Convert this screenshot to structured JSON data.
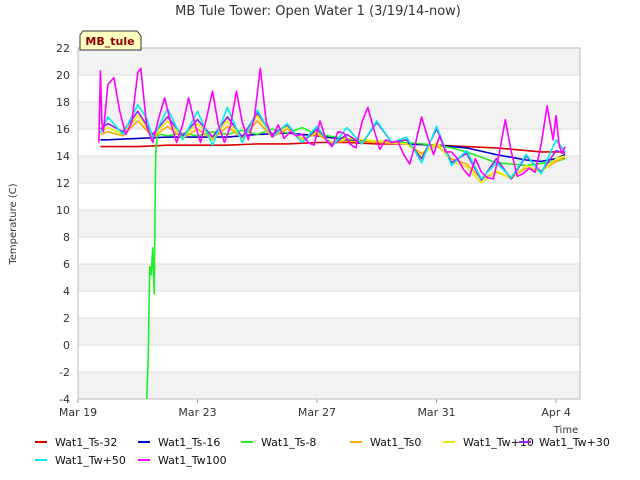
{
  "chart_data": {
    "type": "line",
    "title": "MB Tule Tower: Open Water 1 (3/19/14-now)",
    "badge": "MB_tule",
    "ylabel": "Temperature (C)",
    "xlabel": "Time",
    "ylim": [
      -4,
      22
    ],
    "yticks": [
      -4,
      -2,
      0,
      2,
      4,
      6,
      8,
      10,
      12,
      14,
      16,
      18,
      20,
      22
    ],
    "xlim": [
      0,
      16.8
    ],
    "xticks": [
      {
        "value": 0,
        "label": "Mar 19"
      },
      {
        "value": 4,
        "label": "Mar 23"
      },
      {
        "value": 8,
        "label": "Mar 27"
      },
      {
        "value": 12,
        "label": "Mar 31"
      },
      {
        "value": 16,
        "label": "Apr 4"
      }
    ],
    "grid": true,
    "band_colors": [
      "#f2f2f2",
      "#ffffff"
    ],
    "series": [
      {
        "name": "Wat1_Ts-32",
        "color": "#dd0000",
        "x": [
          0.75,
          1,
          2,
          3,
          4,
          5,
          6,
          7,
          8,
          9,
          10,
          11,
          12,
          13,
          14,
          15,
          15.5,
          16,
          16.3
        ],
        "y": [
          14.7,
          14.7,
          14.7,
          14.8,
          14.8,
          14.8,
          14.9,
          14.9,
          15.0,
          15.0,
          14.9,
          14.9,
          14.8,
          14.7,
          14.6,
          14.4,
          14.3,
          14.3,
          14.3
        ]
      },
      {
        "name": "Wat1_Ts-16",
        "color": "#0000cc",
        "x": [
          0.75,
          1,
          2,
          3,
          4,
          5,
          6,
          7,
          8,
          9,
          10,
          11,
          12,
          13,
          14,
          15,
          15.5,
          16,
          16.3
        ],
        "y": [
          15.2,
          15.2,
          15.3,
          15.4,
          15.4,
          15.4,
          15.6,
          15.7,
          15.5,
          15.2,
          15.0,
          14.9,
          14.8,
          14.6,
          14.1,
          13.7,
          13.6,
          13.8,
          14.1
        ]
      },
      {
        "name": "Wat1_Ts-8",
        "color": "#22ee22",
        "x": [
          2.3,
          2.35,
          2.4,
          2.45,
          2.5,
          2.55,
          2.6,
          2.65,
          2.75,
          3,
          3.5,
          4,
          4.5,
          5,
          5.5,
          6,
          6.5,
          7,
          7.5,
          8,
          9,
          10,
          11,
          12,
          12.5,
          13,
          13.5,
          14,
          15,
          16,
          16.3
        ],
        "y": [
          -4.0,
          -1.0,
          5.8,
          5.2,
          7.2,
          3.8,
          14.2,
          15.5,
          15.6,
          15.5,
          15.7,
          15.5,
          15.8,
          15.6,
          15.9,
          15.6,
          16.0,
          15.7,
          16.1,
          15.6,
          15.3,
          15.1,
          15.0,
          14.8,
          14.6,
          14.3,
          13.9,
          13.5,
          13.3,
          13.6,
          13.8
        ]
      },
      {
        "name": "Wat1_Ts0",
        "color": "#ffaa00",
        "x": [
          0.75,
          1,
          1.5,
          2,
          2.5,
          3,
          3.5,
          4,
          4.5,
          5,
          5.5,
          6,
          6.5,
          7,
          7.5,
          8,
          8.5,
          9,
          10,
          11,
          11.5,
          12,
          12.5,
          13,
          13.5,
          14,
          14.5,
          15,
          15.5,
          16,
          16.3
        ],
        "y": [
          15.6,
          15.8,
          15.5,
          16.6,
          15.4,
          16.2,
          15.3,
          16.0,
          15.2,
          16.2,
          15.3,
          16.6,
          15.4,
          16.0,
          15.3,
          15.6,
          15.0,
          15.1,
          15.0,
          14.9,
          14.2,
          14.8,
          13.8,
          13.4,
          12.3,
          12.8,
          12.4,
          13.1,
          12.9,
          13.6,
          13.9
        ]
      },
      {
        "name": "Wat1_Tw+10",
        "color": "#eeee00",
        "x": [
          0.75,
          1,
          1.5,
          2,
          2.5,
          3,
          3.5,
          4,
          4.5,
          5,
          5.5,
          6,
          6.5,
          7,
          7.5,
          8,
          8.5,
          9,
          10,
          11,
          11.5,
          12,
          12.5,
          13,
          13.5,
          14,
          14.5,
          15,
          15.5,
          16,
          16.3
        ],
        "y": [
          15.8,
          16.1,
          15.6,
          17.0,
          15.5,
          16.6,
          15.4,
          16.4,
          15.3,
          16.6,
          15.3,
          17.0,
          15.5,
          16.2,
          15.2,
          15.8,
          15.0,
          15.3,
          15.1,
          14.9,
          14.0,
          15.0,
          13.6,
          13.2,
          12.0,
          12.9,
          12.3,
          13.3,
          12.8,
          13.8,
          14.0
        ]
      },
      {
        "name": "Wat1_Tw+30",
        "color": "#9922ee",
        "x": [
          0.75,
          1,
          1.5,
          2,
          2.5,
          3,
          3.5,
          4,
          4.5,
          5,
          5.5,
          6,
          6.5,
          7,
          7.5,
          8,
          8.5,
          9,
          9.5,
          10,
          10.5,
          11,
          11.5,
          12,
          12.5,
          13,
          13.5,
          14,
          14.5,
          15,
          15.5,
          16,
          16.3
        ],
        "y": [
          16.0,
          16.4,
          15.8,
          17.3,
          15.6,
          16.9,
          15.5,
          16.7,
          15.4,
          16.9,
          15.4,
          17.2,
          15.6,
          16.3,
          15.0,
          16.0,
          14.8,
          15.6,
          14.9,
          16.5,
          15.0,
          15.2,
          13.8,
          16.0,
          13.5,
          14.2,
          12.2,
          13.8,
          12.3,
          14.0,
          12.8,
          14.4,
          14.2
        ]
      },
      {
        "name": "Wat1_Tw+50",
        "color": "#00eeee",
        "x": [
          0.75,
          1,
          1.5,
          2,
          2.3,
          2.5,
          3,
          3.5,
          4,
          4.5,
          5,
          5.5,
          6,
          6.5,
          7,
          7.5,
          8,
          8.5,
          9,
          9.5,
          10,
          10.5,
          11,
          11.5,
          12,
          12.5,
          13,
          13.5,
          14,
          14.5,
          15,
          15.5,
          16,
          16.3
        ],
        "y": [
          15.7,
          16.9,
          15.6,
          17.8,
          16.8,
          15.3,
          17.5,
          15.2,
          17.3,
          14.8,
          17.6,
          15.0,
          17.4,
          15.4,
          16.4,
          15.0,
          16.2,
          14.7,
          16.1,
          14.9,
          16.6,
          15.0,
          15.4,
          13.5,
          16.2,
          13.3,
          14.4,
          12.3,
          13.5,
          12.4,
          14.1,
          12.7,
          15.2,
          14.3
        ]
      },
      {
        "name": "Wat1_Tw100",
        "color": "#ff00ff",
        "x": [
          0.7,
          0.75,
          0.8,
          0.85,
          1.0,
          1.2,
          1.4,
          1.6,
          1.8,
          2.0,
          2.1,
          2.3,
          2.5,
          2.7,
          2.9,
          3.1,
          3.3,
          3.5,
          3.7,
          3.9,
          4.1,
          4.3,
          4.5,
          4.7,
          4.9,
          5.1,
          5.3,
          5.5,
          5.7,
          5.9,
          6.1,
          6.3,
          6.5,
          6.7,
          6.9,
          7.1,
          7.3,
          7.5,
          7.7,
          7.9,
          8.1,
          8.3,
          8.5,
          8.7,
          8.9,
          9.1,
          9.3,
          9.5,
          9.7,
          9.9,
          10.1,
          10.3,
          10.5,
          10.7,
          10.9,
          11.1,
          11.3,
          11.5,
          11.7,
          11.9,
          12.1,
          12.3,
          12.5,
          12.7,
          12.9,
          13.1,
          13.3,
          13.5,
          13.7,
          13.9,
          14.1,
          14.3,
          14.5,
          14.7,
          14.9,
          15.1,
          15.3,
          15.5,
          15.7,
          15.9,
          16.0,
          16.1,
          16.2,
          16.3
        ],
        "y": [
          15.0,
          20.3,
          16.5,
          15.8,
          19.3,
          19.8,
          17.3,
          15.6,
          16.5,
          20.2,
          20.5,
          16.2,
          15.0,
          16.8,
          18.3,
          16.5,
          15.0,
          16.3,
          18.3,
          16.5,
          15.0,
          16.8,
          18.8,
          16.3,
          15.0,
          16.2,
          18.8,
          16.5,
          15.2,
          16.8,
          20.5,
          16.5,
          15.4,
          16.3,
          15.3,
          15.8,
          15.5,
          15.6,
          15.0,
          14.8,
          16.6,
          15.2,
          14.7,
          15.8,
          15.7,
          14.9,
          14.6,
          16.5,
          17.6,
          16.0,
          14.5,
          15.2,
          15.0,
          15.1,
          14.1,
          13.4,
          15.0,
          16.9,
          15.4,
          14.1,
          15.5,
          14.3,
          14.3,
          13.8,
          13.0,
          12.5,
          13.8,
          12.8,
          12.4,
          12.3,
          14.2,
          16.7,
          14.3,
          12.5,
          12.7,
          13.1,
          12.8,
          14.9,
          17.7,
          15.2,
          17.0,
          14.8,
          14.2,
          14.7
        ]
      }
    ]
  }
}
